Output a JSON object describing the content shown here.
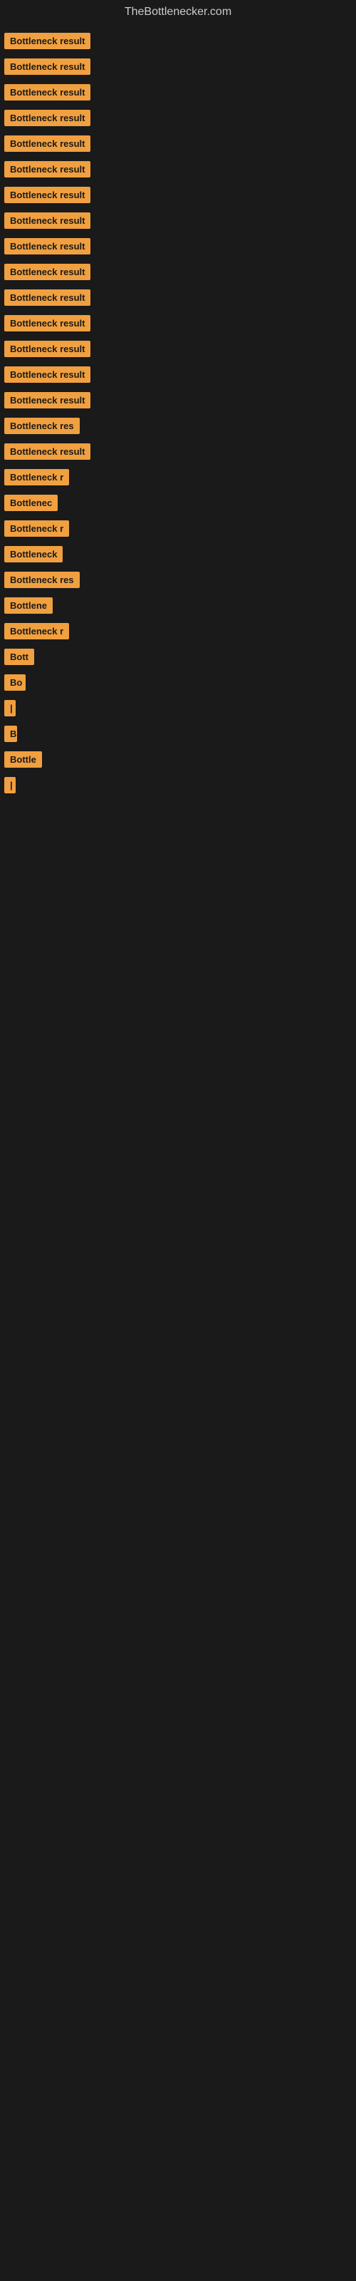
{
  "site": {
    "title": "TheBottlenecker.com"
  },
  "items": [
    {
      "id": 1,
      "label": "Bottleneck result",
      "width": 155
    },
    {
      "id": 2,
      "label": "Bottleneck result",
      "width": 155
    },
    {
      "id": 3,
      "label": "Bottleneck result",
      "width": 155
    },
    {
      "id": 4,
      "label": "Bottleneck result",
      "width": 155
    },
    {
      "id": 5,
      "label": "Bottleneck result",
      "width": 155
    },
    {
      "id": 6,
      "label": "Bottleneck result",
      "width": 155
    },
    {
      "id": 7,
      "label": "Bottleneck result",
      "width": 155
    },
    {
      "id": 8,
      "label": "Bottleneck result",
      "width": 155
    },
    {
      "id": 9,
      "label": "Bottleneck result",
      "width": 155
    },
    {
      "id": 10,
      "label": "Bottleneck result",
      "width": 155
    },
    {
      "id": 11,
      "label": "Bottleneck result",
      "width": 155
    },
    {
      "id": 12,
      "label": "Bottleneck result",
      "width": 145
    },
    {
      "id": 13,
      "label": "Bottleneck result",
      "width": 145
    },
    {
      "id": 14,
      "label": "Bottleneck result",
      "width": 140
    },
    {
      "id": 15,
      "label": "Bottleneck result",
      "width": 135
    },
    {
      "id": 16,
      "label": "Bottleneck res",
      "width": 120
    },
    {
      "id": 17,
      "label": "Bottleneck result",
      "width": 135
    },
    {
      "id": 18,
      "label": "Bottleneck r",
      "width": 105
    },
    {
      "id": 19,
      "label": "Bottlenec",
      "width": 90
    },
    {
      "id": 20,
      "label": "Bottleneck r",
      "width": 105
    },
    {
      "id": 21,
      "label": "Bottleneck",
      "width": 95
    },
    {
      "id": 22,
      "label": "Bottleneck res",
      "width": 115
    },
    {
      "id": 23,
      "label": "Bottlene",
      "width": 80
    },
    {
      "id": 24,
      "label": "Bottleneck r",
      "width": 105
    },
    {
      "id": 25,
      "label": "Bott",
      "width": 50
    },
    {
      "id": 26,
      "label": "Bo",
      "width": 30
    },
    {
      "id": 27,
      "label": "|",
      "width": 12
    },
    {
      "id": 28,
      "label": "B",
      "width": 18
    },
    {
      "id": 29,
      "label": "Bottle",
      "width": 55
    },
    {
      "id": 30,
      "label": "|",
      "width": 12
    }
  ]
}
